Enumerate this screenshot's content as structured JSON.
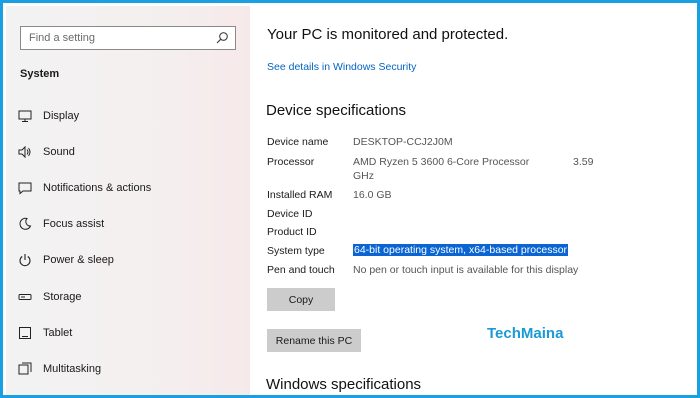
{
  "sidebar": {
    "search_placeholder": "Find a setting",
    "section_title": "System",
    "items": [
      {
        "label": "Display",
        "icon": "monitor-icon"
      },
      {
        "label": "Sound",
        "icon": "speaker-icon"
      },
      {
        "label": "Notifications & actions",
        "icon": "message-icon"
      },
      {
        "label": "Focus assist",
        "icon": "moon-icon"
      },
      {
        "label": "Power & sleep",
        "icon": "power-icon"
      },
      {
        "label": "Storage",
        "icon": "storage-icon"
      },
      {
        "label": "Tablet",
        "icon": "tablet-icon"
      },
      {
        "label": "Multitasking",
        "icon": "multitasking-icon"
      }
    ]
  },
  "main": {
    "protected_heading": "Your PC is monitored and protected.",
    "security_link": "See details in Windows Security",
    "device_heading": "Device specifications",
    "specs": [
      {
        "label": "Device name",
        "value": "DESKTOP-CCJ2J0M"
      },
      {
        "label": "Processor",
        "value": "AMD Ryzen 5 3600 6-Core Processor",
        "value2": "GHz",
        "speed": "3.59"
      },
      {
        "label": "Installed RAM",
        "value": "16.0 GB"
      },
      {
        "label": "Device ID",
        "value": ""
      },
      {
        "label": "Product ID",
        "value": ""
      },
      {
        "label": "System type",
        "value": "64-bit operating system, x64-based processor"
      },
      {
        "label": "Pen and touch",
        "value": "No pen or touch input is available for this display"
      }
    ],
    "copy_button": "Copy",
    "rename_button": "Rename this PC",
    "watermark": "TechMaina",
    "windows_heading": "Windows specifications"
  },
  "colors": {
    "frame_border": "#1a9fe0",
    "link": "#0563c1",
    "selection": "#0a64d2",
    "watermark": "#1b9ad6"
  }
}
